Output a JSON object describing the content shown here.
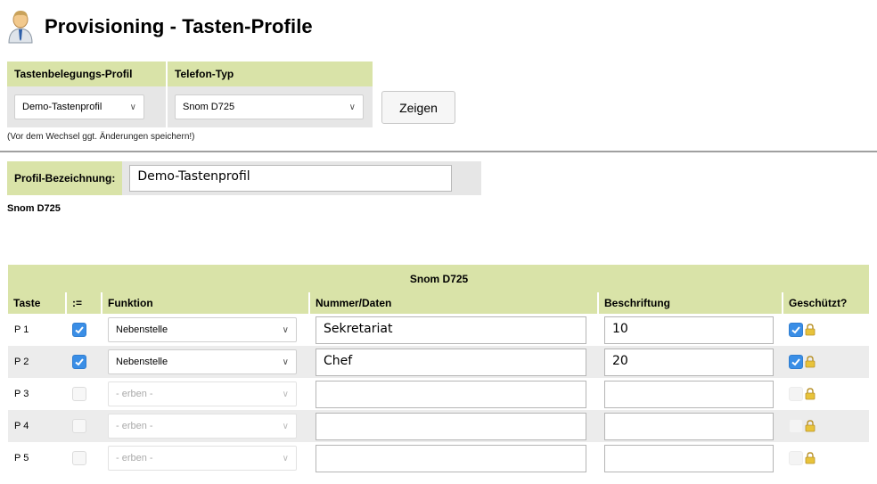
{
  "page": {
    "title": "Provisioning - Tasten-Profile"
  },
  "selector": {
    "profile_header": "Tastenbelegungs-Profil",
    "phone_header": "Telefon-Typ",
    "profile_value": "Demo-Tastenprofil",
    "phone_value": "Snom D725",
    "show_button": "Zeigen",
    "note": "(Vor dem Wechsel ggt. Änderungen speichern!)"
  },
  "profile": {
    "label": "Profil-Bezeichnung:",
    "name": "Demo-Tastenprofil",
    "phone_model": "Snom D725"
  },
  "keys_table": {
    "caption": "Snom D725",
    "columns": [
      "Taste",
      ":=",
      "Funktion",
      "Nummer/Daten",
      "Beschriftung",
      "Geschützt?"
    ],
    "rows": [
      {
        "key": "P 1",
        "override": true,
        "function": "Nebenstelle",
        "number": "Sekretariat",
        "label": "10",
        "protected": true
      },
      {
        "key": "P 2",
        "override": true,
        "function": "Nebenstelle",
        "number": "Chef",
        "label": "20",
        "protected": true
      },
      {
        "key": "P 3",
        "override": false,
        "function": "- erben -",
        "number": "",
        "label": "",
        "protected": false
      },
      {
        "key": "P 4",
        "override": false,
        "function": "- erben -",
        "number": "",
        "label": "",
        "protected": false
      },
      {
        "key": "P 5",
        "override": false,
        "function": "- erben -",
        "number": "",
        "label": "",
        "protected": false
      }
    ]
  },
  "icons": {
    "user": "user-icon",
    "lock": "lock-icon",
    "chevron": "chevron-down-icon",
    "check": "checkmark-icon"
  },
  "colors": {
    "header_bg": "#d9e3a8",
    "panel_bg": "#e6e6e6",
    "checkbox_on": "#3a8ee6",
    "lock": "#e8c33a"
  }
}
